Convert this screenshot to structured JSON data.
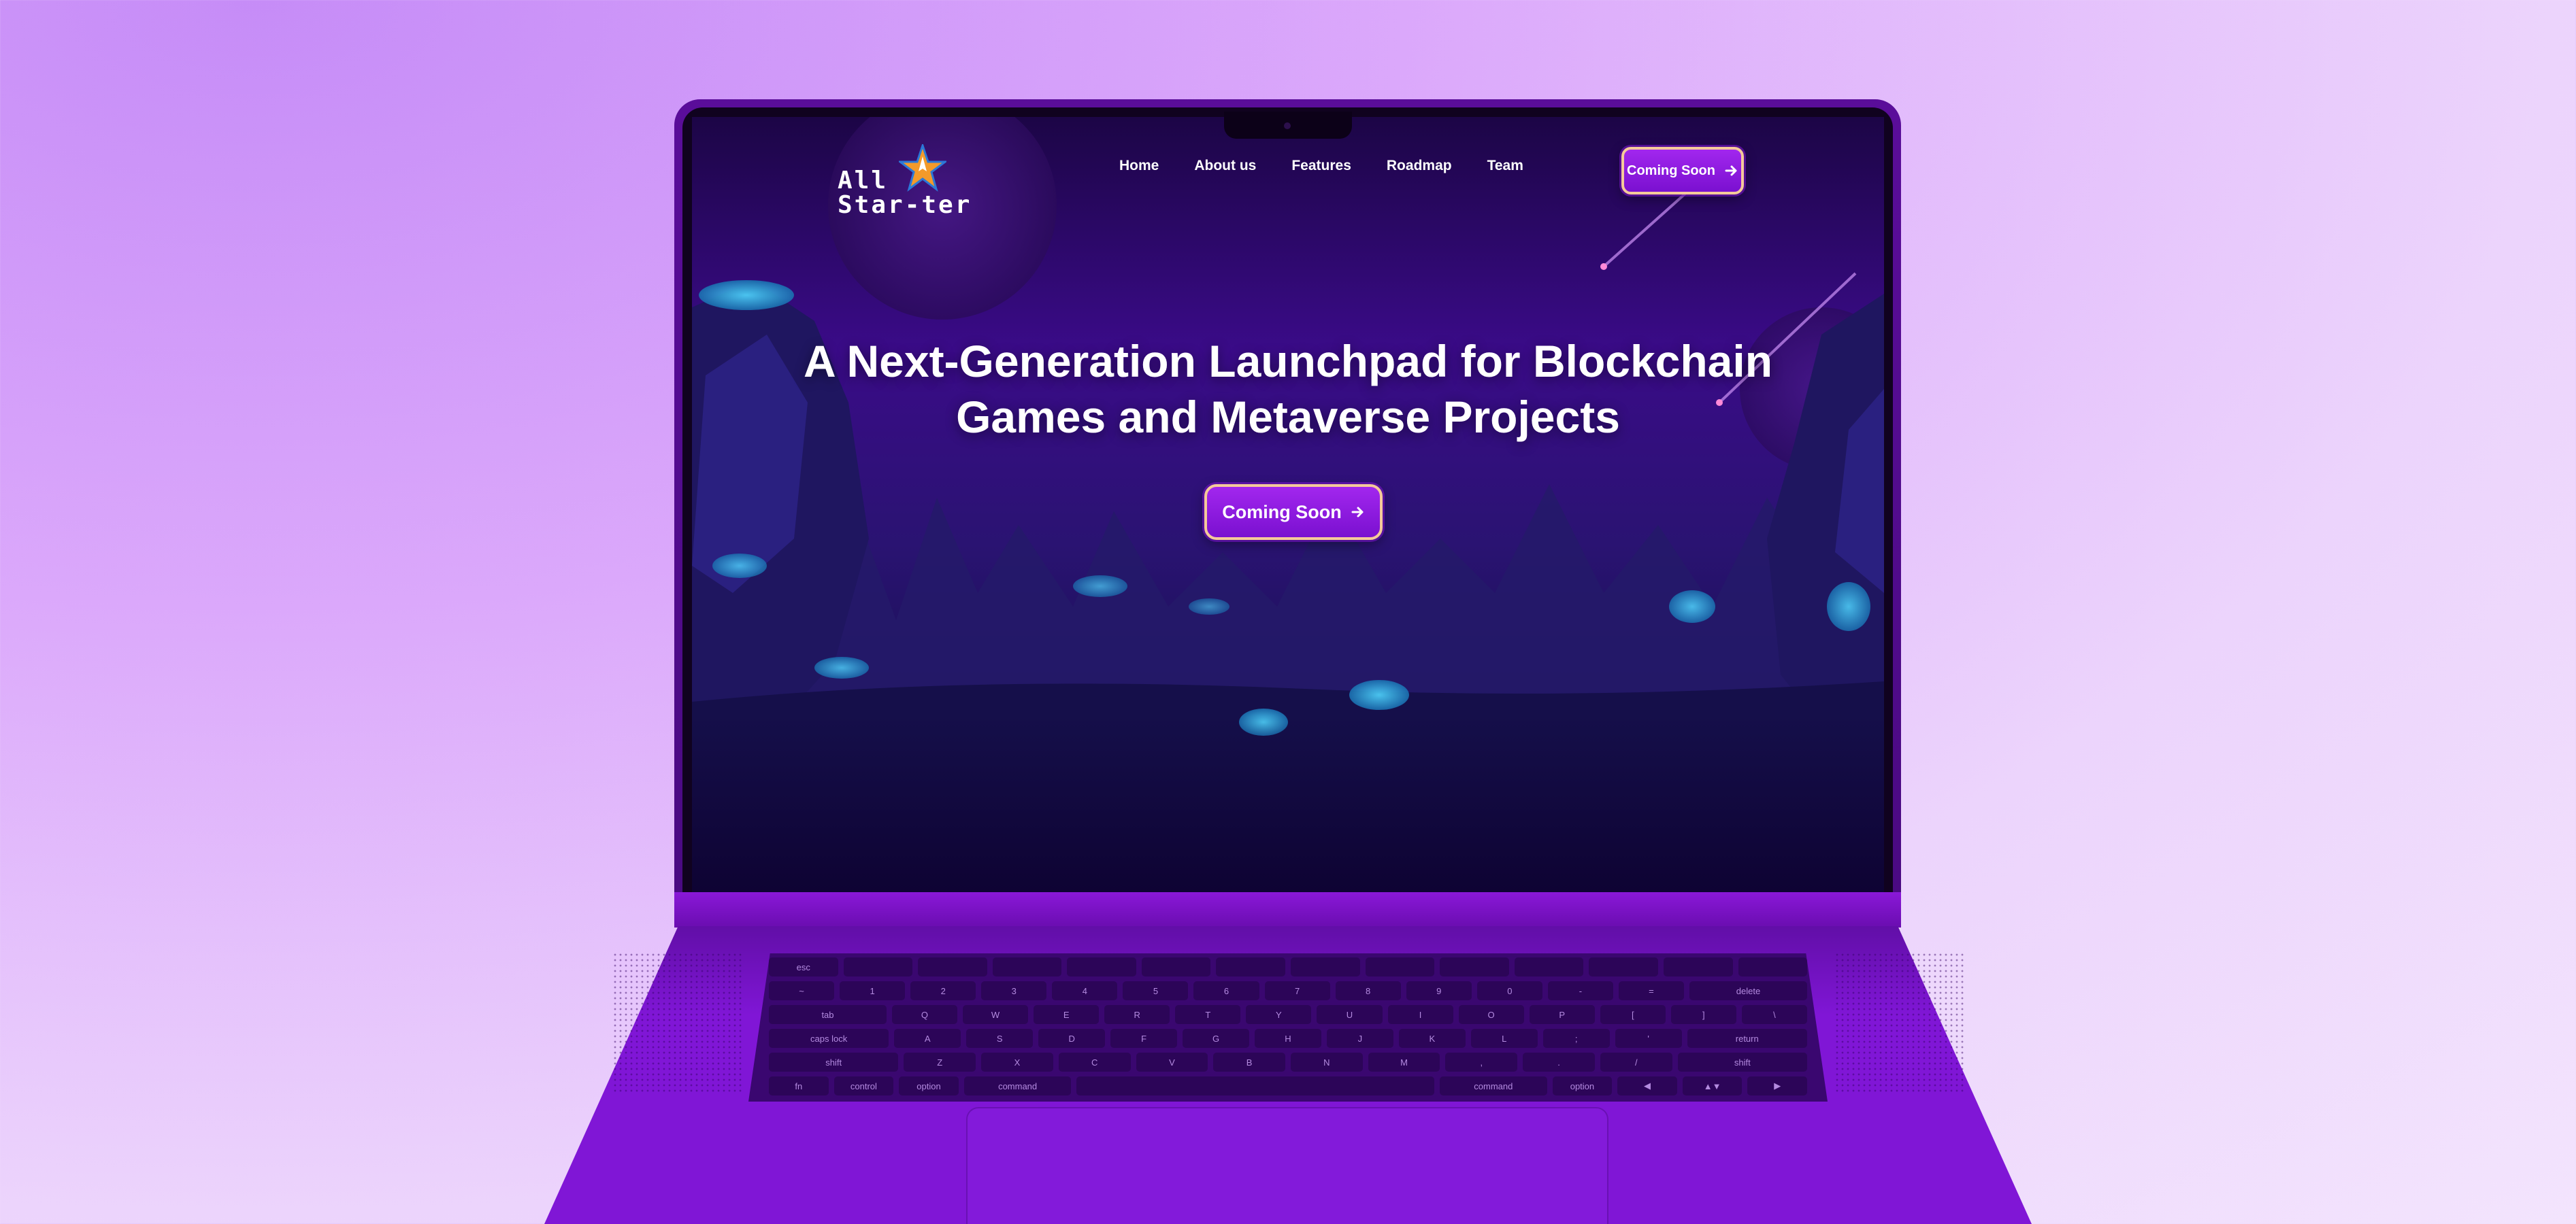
{
  "colors": {
    "background": "#e3bcfb",
    "laptop": "#8016d6",
    "screen_bg": "#0e0333",
    "button_gradient_top": "#a227ee",
    "button_border": "#f5c99a",
    "logo_star": "#f39a2a"
  },
  "logo": {
    "line1": "All",
    "line2": "Star-ter",
    "icon": "rocket-star-icon"
  },
  "nav": {
    "items": [
      {
        "label": "Home"
      },
      {
        "label": "About us"
      },
      {
        "label": "Features"
      },
      {
        "label": "Roadmap"
      },
      {
        "label": "Team"
      }
    ],
    "cta_label": "Coming Soon",
    "cta_icon": "arrow-right-icon"
  },
  "hero": {
    "title_line1": "A Next-Generation Launchpad for Blockchain",
    "title_line2": "Games and Metaverse Projects",
    "cta_label": "Coming Soon",
    "cta_icon": "arrow-right-icon"
  },
  "keyboard": {
    "rows": [
      [
        "esc",
        "",
        "",
        "",
        "",
        "",
        "",
        "",
        "",
        "",
        "",
        "",
        "",
        ""
      ],
      [
        "~",
        "1",
        "2",
        "3",
        "4",
        "5",
        "6",
        "7",
        "8",
        "9",
        "0",
        "-",
        "=",
        "delete"
      ],
      [
        "tab",
        "Q",
        "W",
        "E",
        "R",
        "T",
        "Y",
        "U",
        "I",
        "O",
        "P",
        "[",
        "]",
        "\\"
      ],
      [
        "caps lock",
        "A",
        "S",
        "D",
        "F",
        "G",
        "H",
        "J",
        "K",
        "L",
        ";",
        "'",
        "return"
      ],
      [
        "shift",
        "Z",
        "X",
        "C",
        "V",
        "B",
        "N",
        "M",
        ",",
        ".",
        "/",
        "shift"
      ],
      [
        "fn",
        "control",
        "option",
        "command",
        "",
        "command",
        "option",
        "◀",
        "▲▼",
        "▶"
      ]
    ]
  }
}
